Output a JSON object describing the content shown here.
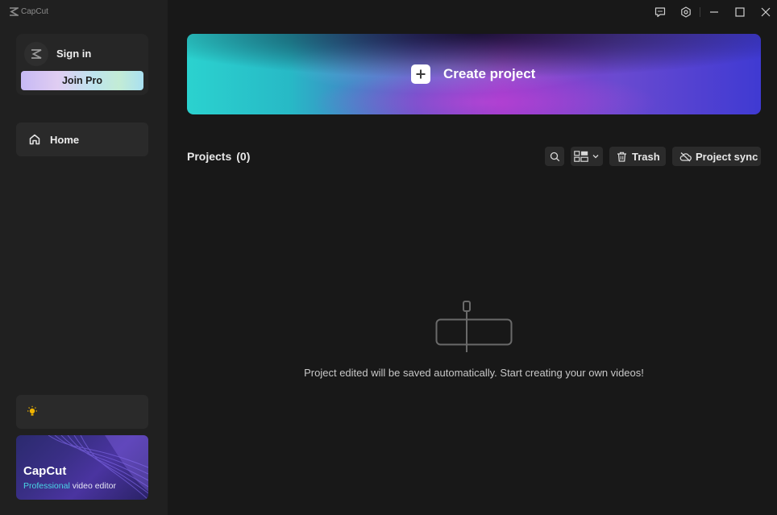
{
  "app": {
    "name": "CapCut",
    "brand_icon": "capcut-logo-icon"
  },
  "sidebar": {
    "sign_in_label": "Sign in",
    "join_pro_label": "Join Pro",
    "nav": [
      {
        "label": "Home",
        "icon": "home-icon",
        "active": true
      }
    ],
    "theme_icon": "lightbulb-icon",
    "promo": {
      "title": "CapCut",
      "subtitle_accent": "Professional",
      "subtitle_rest": " video editor"
    }
  },
  "titlebar": {
    "icons": [
      "feedback-icon",
      "settings-icon",
      "minimize-icon",
      "maximize-icon",
      "close-icon"
    ]
  },
  "main": {
    "create_project_label": "Create project",
    "projects_label": "Projects",
    "projects_count": "(0)",
    "toolbar": {
      "search_icon": "search-icon",
      "view_icon": "grid-view-icon",
      "trash_label": "Trash",
      "sync_label": "Project sync"
    },
    "empty_message": "Project edited will be saved automatically. Start creating your own videos!"
  },
  "colors": {
    "background": "#181818",
    "sidebar": "#202020",
    "card": "#262626",
    "accent_cyan": "#2bd2cf",
    "accent_purple": "#8e3ac7"
  }
}
